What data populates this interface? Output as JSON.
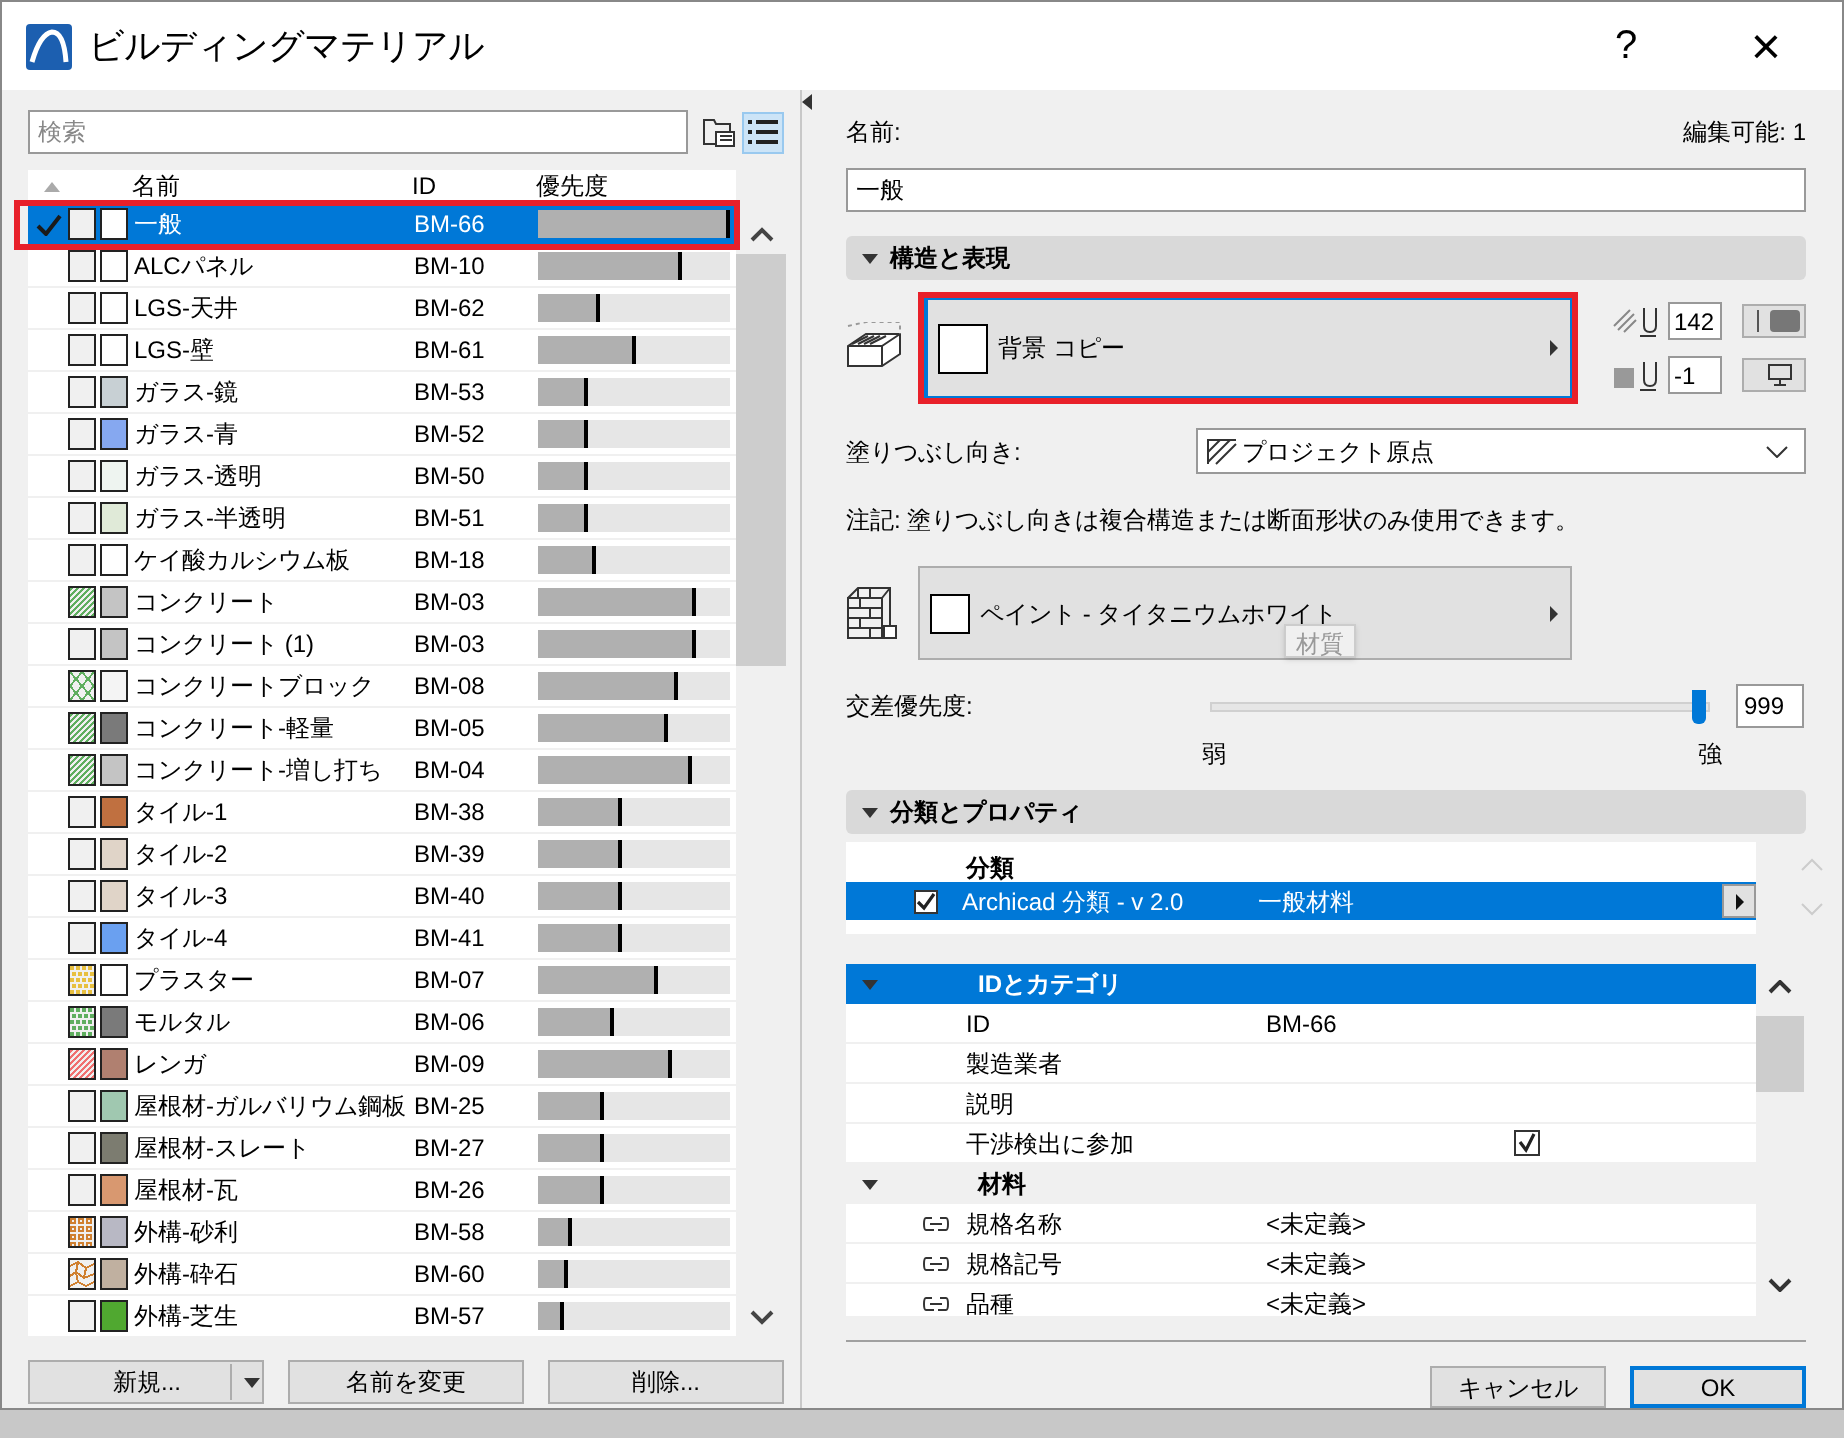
{
  "window": {
    "title": "ビルディングマテリアル",
    "help": "?",
    "close": "×"
  },
  "list": {
    "search_placeholder": "検索",
    "columns": [
      "名前",
      "ID",
      "優先度"
    ],
    "rows": [
      {
        "name": "一般",
        "id": "BM-66",
        "level": 1.0,
        "selected": true,
        "color": "#ffffff"
      },
      {
        "name": "ALCパネル",
        "id": "BM-10",
        "level": 0.75,
        "selected": false,
        "color": "#ffffff"
      },
      {
        "name": "LGS-天井",
        "id": "BM-62",
        "level": 0.32,
        "selected": false,
        "color": "#ffffff"
      },
      {
        "name": "LGS-壁",
        "id": "BM-61",
        "level": 0.51,
        "selected": false,
        "color": "#ffffff"
      },
      {
        "name": "ガラス-鏡",
        "id": "BM-53",
        "level": 0.26,
        "selected": false,
        "color": "#c8d0d4"
      },
      {
        "name": "ガラス-青",
        "id": "BM-52",
        "level": 0.26,
        "selected": false,
        "color": "#86a8f0"
      },
      {
        "name": "ガラス-透明",
        "id": "BM-50",
        "level": 0.26,
        "selected": false,
        "color": "#eef4f0"
      },
      {
        "name": "ガラス-半透明",
        "id": "BM-51",
        "level": 0.26,
        "selected": false,
        "color": "#e0ead8"
      },
      {
        "name": "ケイ酸カルシウム板",
        "id": "BM-18",
        "level": 0.3,
        "selected": false,
        "color": "#ffffff"
      },
      {
        "name": "コンクリート",
        "id": "BM-03",
        "level": 0.82,
        "selected": false,
        "pattern": {
          "kind": "hatch",
          "color": "#5fae5f"
        },
        "color": "#c4c4c4"
      },
      {
        "name": "コンクリート (1)",
        "id": "BM-03",
        "level": 0.82,
        "selected": false,
        "color": "#c4c4c4"
      },
      {
        "name": "コンクリートブロック",
        "id": "BM-08",
        "level": 0.73,
        "selected": false,
        "pattern": {
          "kind": "cross",
          "color": "#5fae5f"
        },
        "color": "#f4f4f4"
      },
      {
        "name": "コンクリート-軽量",
        "id": "BM-05",
        "level": 0.68,
        "selected": false,
        "pattern": {
          "kind": "hatch",
          "color": "#5fae5f"
        },
        "color": "#7a7a7a"
      },
      {
        "name": "コンクリート-増し打ち",
        "id": "BM-04",
        "level": 0.8,
        "selected": false,
        "pattern": {
          "kind": "hatch",
          "color": "#5fae5f"
        },
        "color": "#c4c4c4"
      },
      {
        "name": "タイル-1",
        "id": "BM-38",
        "level": 0.44,
        "selected": false,
        "color": "#c07040"
      },
      {
        "name": "タイル-2",
        "id": "BM-39",
        "level": 0.44,
        "selected": false,
        "color": "#e0d4c8"
      },
      {
        "name": "タイル-3",
        "id": "BM-40",
        "level": 0.44,
        "selected": false,
        "color": "#e0d4c8"
      },
      {
        "name": "タイル-4",
        "id": "BM-41",
        "level": 0.44,
        "selected": false,
        "color": "#6aa0f0"
      },
      {
        "name": "プラスター",
        "id": "BM-07",
        "level": 0.62,
        "selected": false,
        "pattern": {
          "kind": "dots",
          "color": "#e8c040"
        },
        "color": "#ffffff"
      },
      {
        "name": "モルタル",
        "id": "BM-06",
        "level": 0.4,
        "selected": false,
        "pattern": {
          "kind": "dots",
          "color": "#5fae5f"
        },
        "color": "#7a7a7a"
      },
      {
        "name": "レンガ",
        "id": "BM-09",
        "level": 0.7,
        "selected": false,
        "pattern": {
          "kind": "hatch",
          "color": "#f07070"
        },
        "color": "#b08070"
      },
      {
        "name": "屋根材-ガルバリウム鋼板",
        "id": "BM-25",
        "level": 0.34,
        "selected": false,
        "color": "#a0c8b0"
      },
      {
        "name": "屋根材-スレート",
        "id": "BM-27",
        "level": 0.34,
        "selected": false,
        "color": "#7c7c70"
      },
      {
        "name": "屋根材-瓦",
        "id": "BM-26",
        "level": 0.34,
        "selected": false,
        "color": "#d89870"
      },
      {
        "name": "外構-砂利",
        "id": "BM-58",
        "level": 0.18,
        "selected": false,
        "pattern": {
          "kind": "gravel",
          "color": "#d08030"
        },
        "color": "#b8b8c4"
      },
      {
        "name": "外構-砕石",
        "id": "BM-60",
        "level": 0.16,
        "selected": false,
        "pattern": {
          "kind": "stone",
          "color": "#d08030"
        },
        "color": "#c0b0a0"
      },
      {
        "name": "外構-芝生",
        "id": "BM-57",
        "level": 0.14,
        "selected": false,
        "color": "#50a830"
      }
    ],
    "buttons": [
      "新規...",
      "名前を変更",
      "削除..."
    ]
  },
  "details": {
    "name_label": "名前:",
    "editable": "編集可能: 1",
    "name_value": "一般",
    "structure": {
      "title": "構造と表現",
      "expanded": true,
      "surface": {
        "label": "背景 コピー",
        "color": "#ffffff",
        "highlighted": true
      },
      "cut_fill_pen": "142",
      "background_pen": "-1",
      "orientation_label": "塗りつぶし向き:",
      "orientation_value": "プロジェクト原点",
      "note": "注記: 塗りつぶし向きは複合構造または断面形状のみ使用できます。",
      "material": {
        "label": "ペイント - タイタニウムホワイト",
        "color": "#ffffff",
        "tooltip": "材質"
      },
      "priority": {
        "label": "交差優先度:",
        "level": 0.985,
        "value": "999",
        "min_label": "弱",
        "max_label": "強"
      }
    },
    "classification": {
      "title": "分類とプロパティ",
      "expanded": true,
      "header": "分類",
      "rows": [
        {
          "checked": true,
          "system": "Archicad 分類 - v 2.0",
          "value": "一般材料",
          "selected": true
        }
      ]
    },
    "properties": [
      {
        "title": "IDとカテゴリ",
        "expanded": true,
        "selected": true,
        "rows": [
          {
            "kind": "text",
            "name": "ID",
            "value": "BM-66",
            "linked": false
          },
          {
            "kind": "text",
            "name": "製造業者",
            "value": "",
            "linked": false
          },
          {
            "kind": "text",
            "name": "説明",
            "value": "",
            "linked": false
          },
          {
            "kind": "checkbox",
            "name": "干渉検出に参加",
            "checked": true,
            "linked": false
          }
        ]
      },
      {
        "title": "材料",
        "expanded": true,
        "selected": false,
        "rows": [
          {
            "kind": "text",
            "name": "規格名称",
            "value": "<未定義>",
            "linked": true
          },
          {
            "kind": "text",
            "name": "規格記号",
            "value": "<未定義>",
            "linked": true
          },
          {
            "kind": "text",
            "name": "品種",
            "value": "<未定義>",
            "linked": true
          }
        ]
      }
    ]
  },
  "buttons": [
    {
      "label": "キャンセル",
      "default": false
    },
    {
      "label": "OK",
      "default": true
    }
  ]
}
